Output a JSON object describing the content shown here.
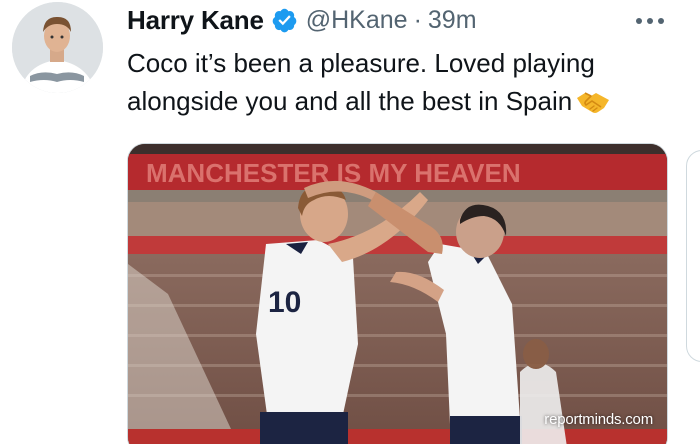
{
  "tweet": {
    "display_name": "Harry Kane",
    "handle": "@HKane",
    "separator": "·",
    "timestamp": "39m",
    "text": "Coco it’s been a pleasure. Loved playing alongside you and all the best in Spain",
    "emoji": "handshake-icon",
    "verified_icon": "verified-badge-icon",
    "more_icon": "more-options-icon"
  },
  "media": {
    "stadium_banner_text": "MANCHESTER IS MY HEAVEN",
    "player_number": "10",
    "watermark": "reportminds.com"
  },
  "colors": {
    "accent": "#1d9bf0",
    "text_primary": "#0f1419",
    "text_secondary": "#536471",
    "border": "#cfd9de"
  }
}
